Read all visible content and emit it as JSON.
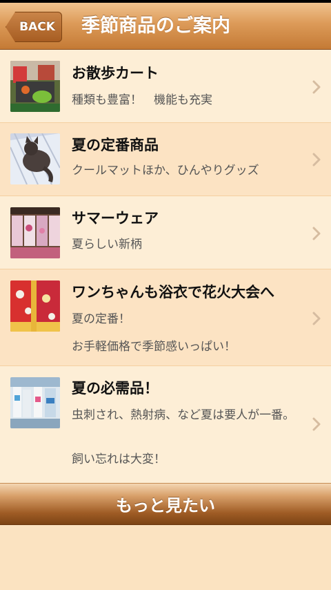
{
  "header": {
    "back_label": "BACK",
    "title": "季節商品のご案内"
  },
  "items": [
    {
      "title": "お散歩カート",
      "desc": "種類も豊富！　機能も充実",
      "image": "pet-cart-photo"
    },
    {
      "title": "夏の定番商品",
      "desc": "クールマットほか、ひんやりグッズ",
      "image": "cat-on-cool-mat-photo"
    },
    {
      "title": "サマーウェア",
      "desc": "夏らしい新柄",
      "image": "summer-wear-photo"
    },
    {
      "title": "ワンちゃんも浴衣で花火大会へ",
      "desc": "夏の定番！",
      "desc2": "お手軽価格で季節感いっぱい！",
      "image": "dog-yukata-photo"
    },
    {
      "title": "夏の必需品！",
      "desc": "虫刺され、熱射病、など夏は要人が一番。",
      "desc2": "飼い忘れは大変！",
      "image": "summer-essentials-photo"
    }
  ],
  "more_label": "もっと見たい",
  "colors": {
    "header_top": "#f0c38f",
    "header_bottom": "#c47a35",
    "row_odd": "#fdeed6",
    "row_even": "#fce3c3",
    "chevron": "#d6bca0"
  }
}
